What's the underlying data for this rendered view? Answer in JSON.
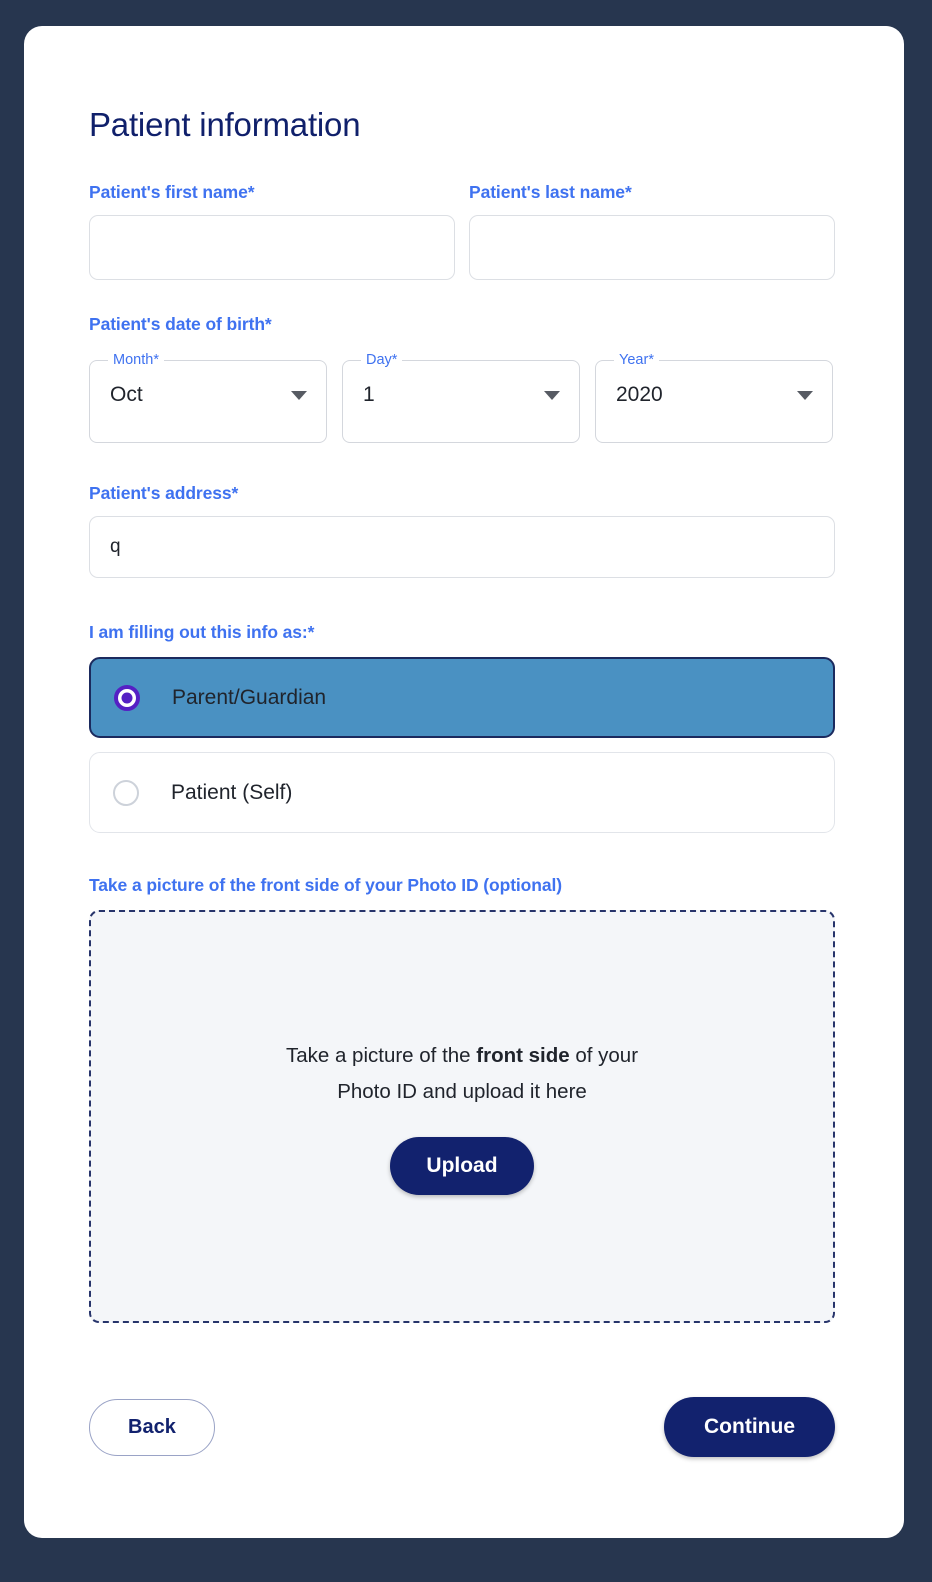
{
  "theme": {
    "page_background": "#27364f",
    "card_background": "#ffffff",
    "label_blue": "#3f72f0",
    "title_navy": "#10206b",
    "primary_navy": "#12226e",
    "selected_row_blue": "#4a91c2",
    "radio_purple": "#5520c4",
    "dropzone_fill": "#f4f6f9"
  },
  "form": {
    "title": "Patient information",
    "first_name": {
      "label": "Patient's first name",
      "required_mark": "*",
      "value": "",
      "placeholder": ""
    },
    "last_name": {
      "label": "Patient's last name",
      "required_mark": "*",
      "value": "",
      "placeholder": ""
    },
    "date_of_birth": {
      "label": "Patient's date of birth",
      "required_mark": "*",
      "month": {
        "label": "Month",
        "required_mark": "*",
        "value": "Oct"
      },
      "day": {
        "label": "Day",
        "required_mark": "*",
        "value": "1"
      },
      "year": {
        "label": "Year",
        "required_mark": "*",
        "value": "2020"
      }
    },
    "address": {
      "label": "Patient's address",
      "required_mark": "*",
      "value": "q",
      "placeholder": ""
    },
    "filling_out_as": {
      "label": "I am filling out this info as:",
      "required_mark": "*",
      "options": [
        {
          "label": "Parent/Guardian",
          "selected": true
        },
        {
          "label": "Patient (Self)",
          "selected": false
        }
      ]
    },
    "photo_id": {
      "label": "Take a picture of the front side of your Photo ID (optional)",
      "dropzone_text_before": "Take a picture of the ",
      "dropzone_text_bold": "front side",
      "dropzone_text_after": " of your Photo ID and upload it here",
      "upload_button": "Upload"
    },
    "footer": {
      "back_label": "Back",
      "continue_label": "Continue"
    }
  }
}
